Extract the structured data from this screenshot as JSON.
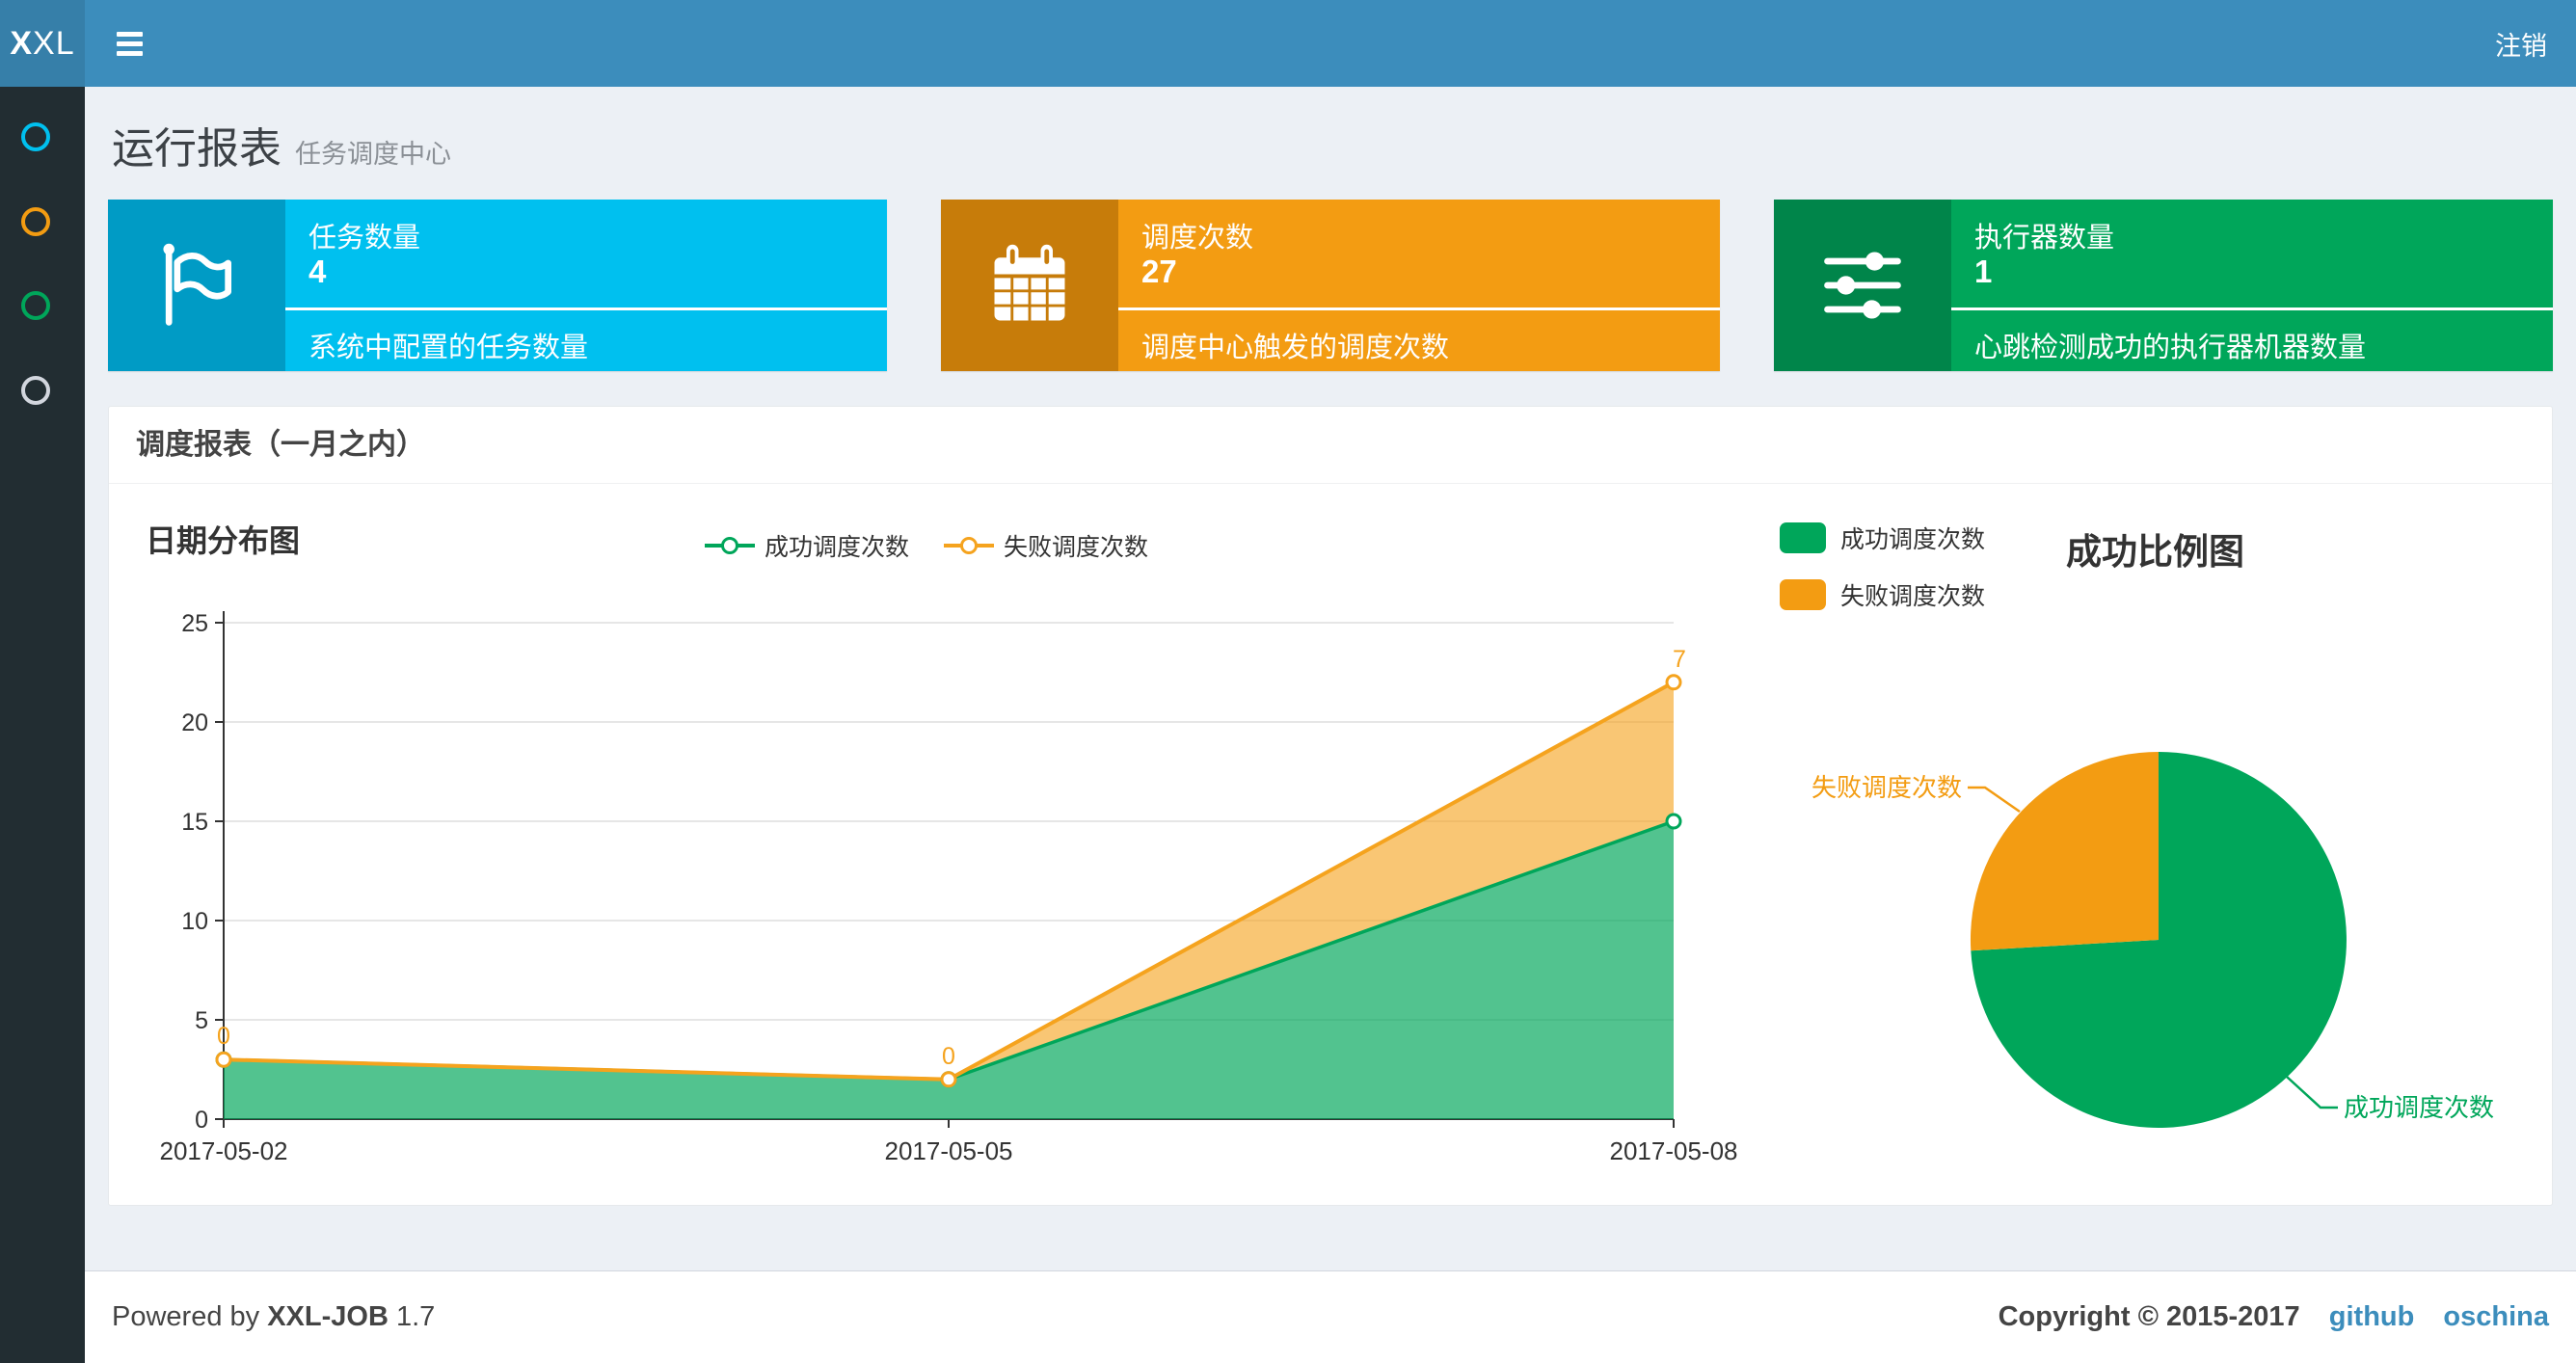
{
  "navbar": {
    "logo_bold": "X",
    "logo_rest": "XL",
    "logout_label": "注销"
  },
  "sidebar": {
    "items": [
      {
        "name": "menu-item-1",
        "color": "#00c0ef"
      },
      {
        "name": "menu-item-2",
        "color": "#f39c12"
      },
      {
        "name": "menu-item-3",
        "color": "#00a65a"
      },
      {
        "name": "menu-item-4",
        "color": "#d2d6de"
      }
    ]
  },
  "page_header": {
    "title": "运行报表",
    "subtitle": "任务调度中心"
  },
  "info_boxes": [
    {
      "title": "任务数量",
      "value": "4",
      "description": "系统中配置的任务数量",
      "bg": "#00c0ef",
      "icon_bg": "#009bc5",
      "icon": "flag-icon"
    },
    {
      "title": "调度次数",
      "value": "27",
      "description": "调度中心触发的调度次数",
      "bg": "#f39c12",
      "icon_bg": "#c77c0a",
      "icon": "calendar-icon"
    },
    {
      "title": "执行器数量",
      "value": "1",
      "description": "心跳检测成功的执行器机器数量",
      "bg": "#00a65a",
      "icon_bg": "#00854a",
      "icon": "sliders-icon"
    }
  ],
  "panel": {
    "title": "调度报表（一月之内）"
  },
  "chart_data": [
    {
      "type": "area",
      "title": "日期分布图",
      "stacked": true,
      "x": [
        "2017-05-02",
        "2017-05-05",
        "2017-05-08"
      ],
      "series": [
        {
          "name": "成功调度次数",
          "values": [
            3,
            2,
            15
          ],
          "color": "#00a65a"
        },
        {
          "name": "失败调度次数",
          "values": [
            0,
            0,
            7
          ],
          "color": "#f5a31e",
          "point_labels": [
            "0",
            "0",
            "7"
          ]
        }
      ],
      "ylim": [
        0,
        25
      ],
      "yticks": [
        0,
        5,
        10,
        15,
        20,
        25
      ],
      "grid": true,
      "legend_position": "top-center"
    },
    {
      "type": "pie",
      "title": "成功比例图",
      "slices": [
        {
          "label": "成功调度次数",
          "value": 20,
          "color": "#00a65a"
        },
        {
          "label": "失败调度次数",
          "value": 7,
          "color": "#f39c12"
        }
      ],
      "legend_position": "top-left"
    }
  ],
  "footer": {
    "powered_prefix": "Powered by",
    "product": "XXL-JOB",
    "version": "1.7",
    "copyright": "Copyright © 2015-2017",
    "links": [
      {
        "label": "github"
      },
      {
        "label": "oschina"
      }
    ]
  }
}
